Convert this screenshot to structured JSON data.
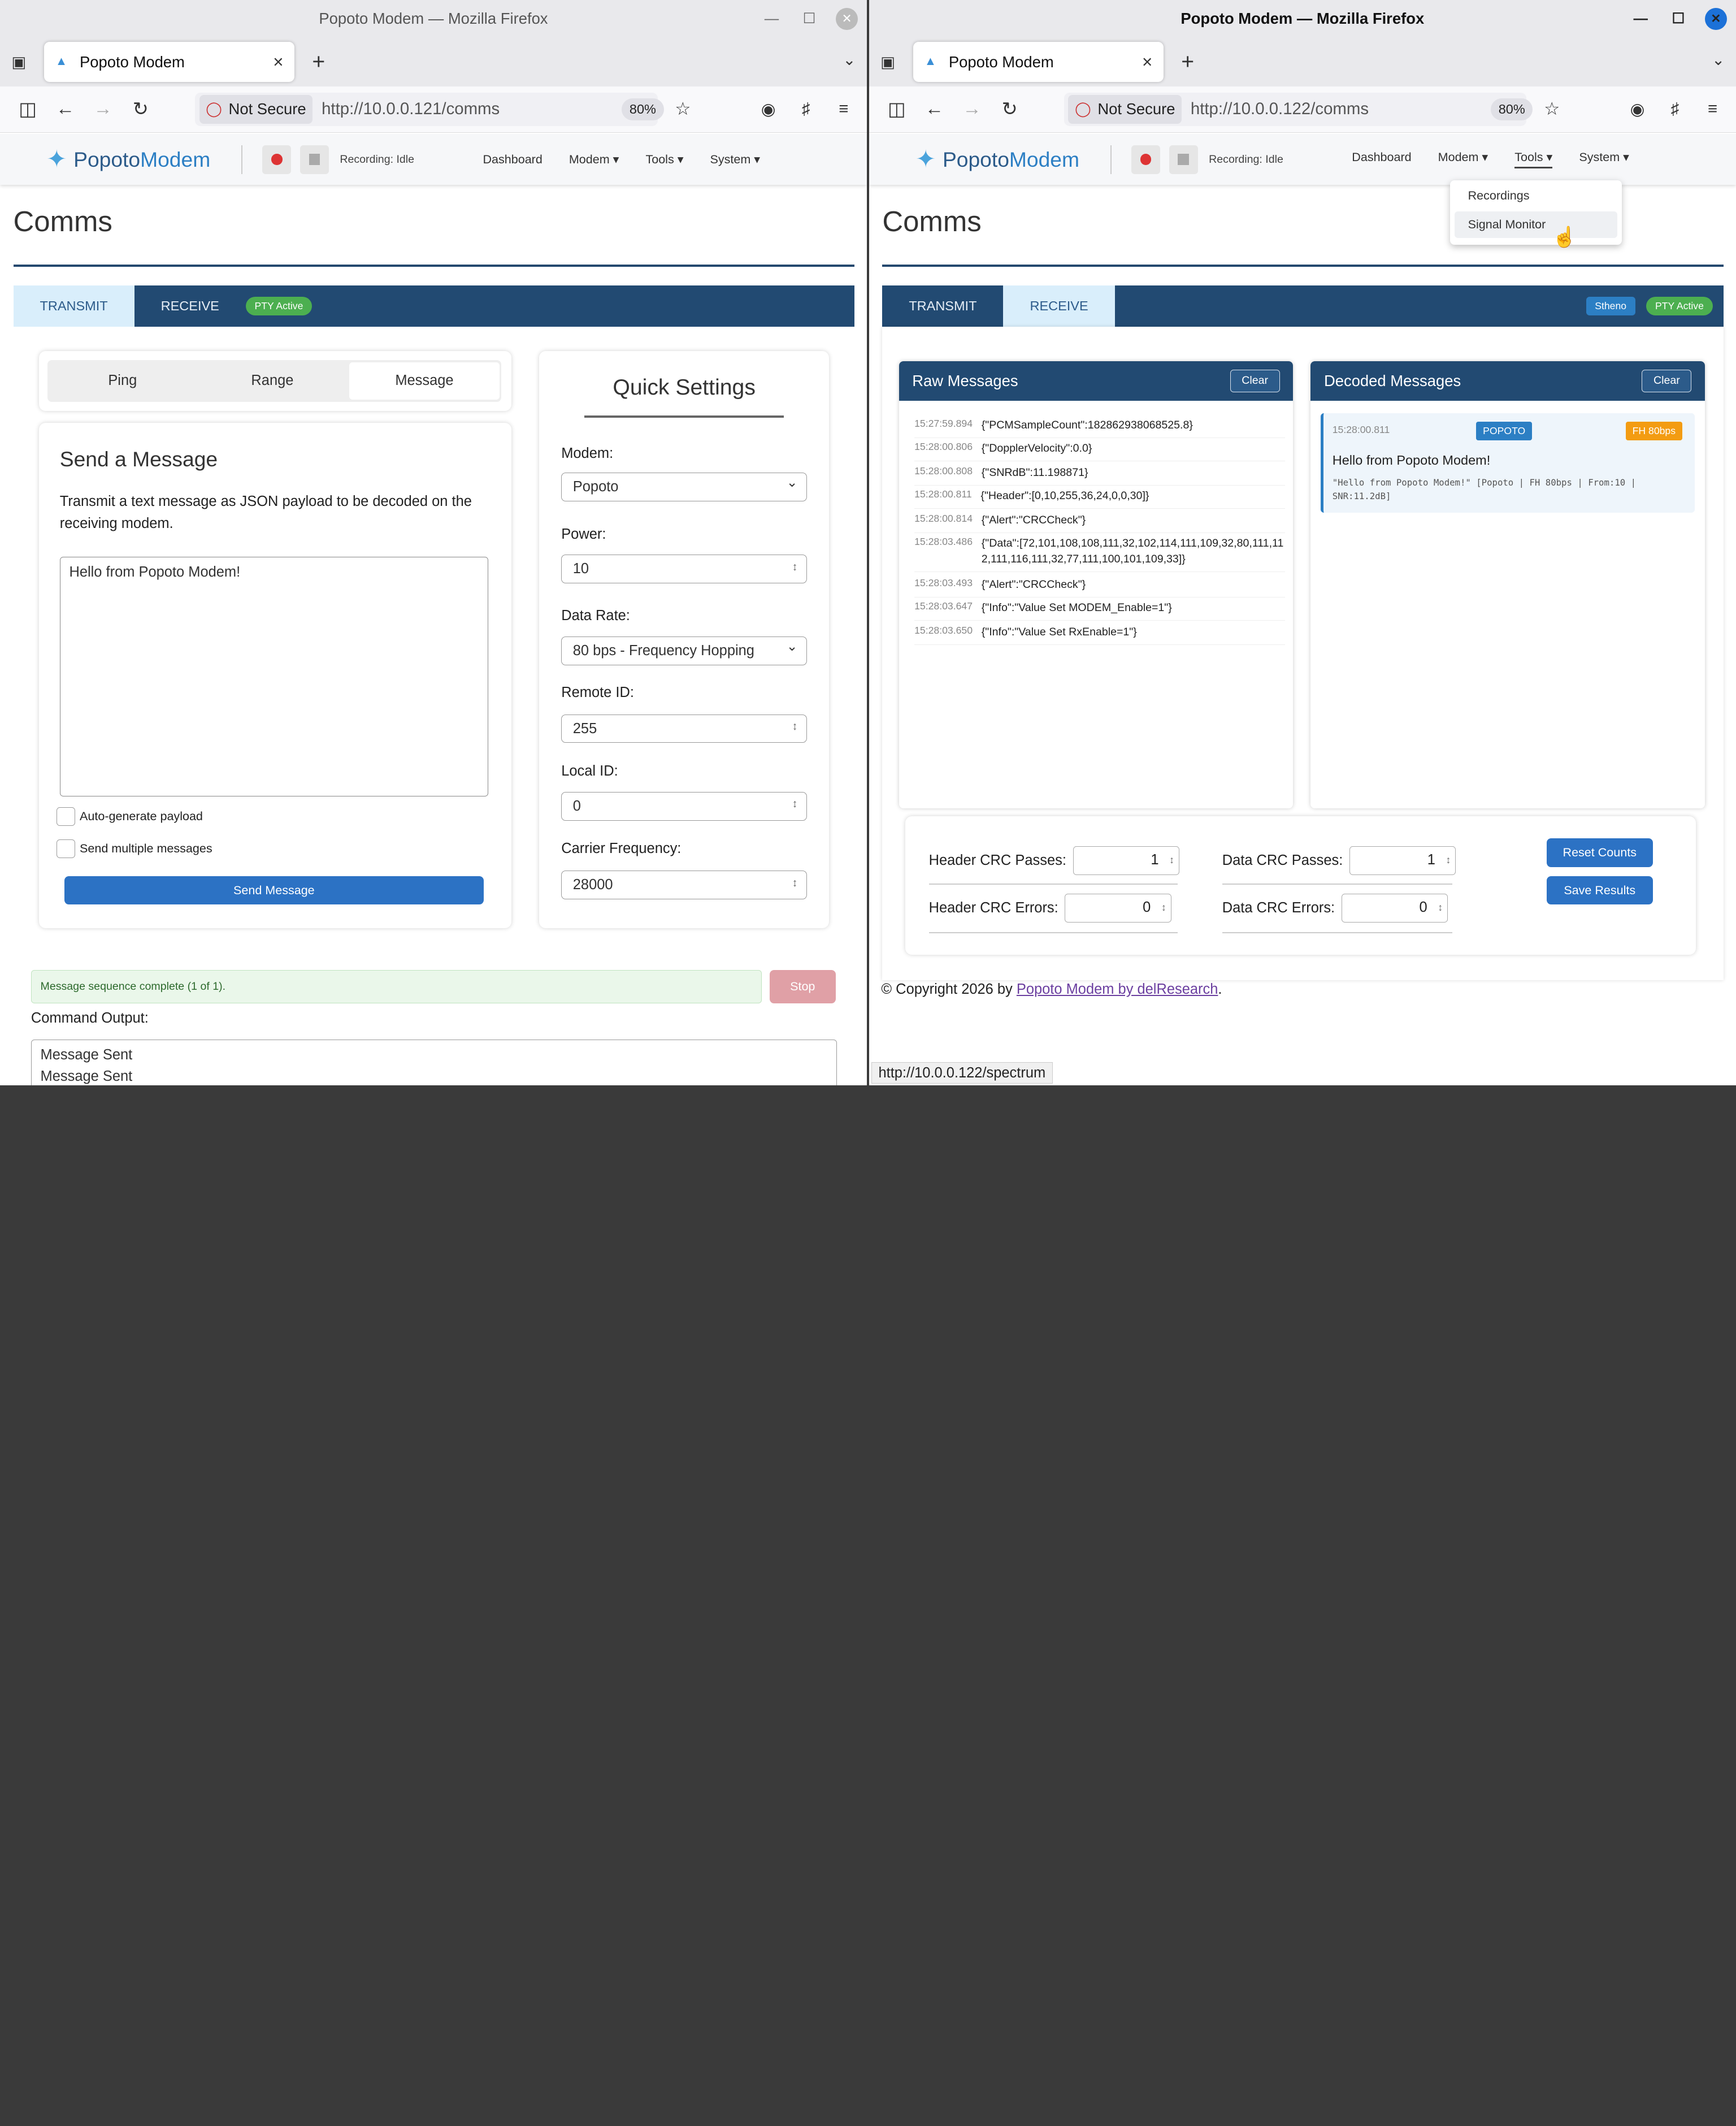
{
  "left": {
    "title": "Popoto Modem — Mozilla Firefox",
    "tab": "Popoto Modem",
    "not_secure": "Not Secure",
    "url": "http://10.0.0.121/comms",
    "zoom": "80%",
    "brand": {
      "a": "Popoto",
      "b": "Modem"
    },
    "rec": "Recording: Idle",
    "menu": [
      "Dashboard",
      "Modem",
      "Tools",
      "System"
    ],
    "heading": "Comms",
    "tabs": {
      "transmit": "TRANSMIT",
      "receive": "RECEIVE",
      "pty": "PTY Active"
    },
    "seg": [
      "Ping",
      "Range",
      "Message"
    ],
    "send_title": "Send a Message",
    "send_desc": "Transmit a text message as JSON payload to be decoded on the receiving modem.",
    "message": "Hello from Popoto Modem!",
    "cb1": "Auto-generate payload",
    "cb2": "Send multiple messages",
    "send_btn": "Send Message",
    "qs": {
      "title": "Quick Settings",
      "modem_l": "Modem:",
      "modem_v": "Popoto",
      "power_l": "Power:",
      "power_v": "10",
      "rate_l": "Data Rate:",
      "rate_v": "80 bps - Frequency Hopping",
      "rid_l": "Remote ID:",
      "rid_v": "255",
      "lid_l": "Local ID:",
      "lid_v": "0",
      "cf_l": "Carrier Frequency:",
      "cf_v": "28000"
    },
    "status": "Message sequence complete (1 of 1).",
    "stop": "Stop",
    "cmd_label": "Command Output:",
    "cmd_lines": [
      "Message Sent",
      "Message Sent"
    ]
  },
  "right": {
    "title": "Popoto Modem — Mozilla Firefox",
    "tab": "Popoto Modem",
    "not_secure": "Not Secure",
    "url": "http://10.0.0.122/comms",
    "zoom": "80%",
    "brand": {
      "a": "Popoto",
      "b": "Modem"
    },
    "rec": "Recording: Idle",
    "menu": [
      "Dashboard",
      "Modem",
      "Tools",
      "System"
    ],
    "dropdown": [
      "Recordings",
      "Signal Monitor"
    ],
    "heading": "Comms",
    "tabs": {
      "transmit": "TRANSMIT",
      "receive": "RECEIVE",
      "stheno": "Stheno",
      "pty": "PTY Active"
    },
    "raw_title": "Raw Messages",
    "dec_title": "Decoded Messages",
    "clear": "Clear",
    "raw": [
      {
        "ts": "15:27:59.894",
        "msg": "{\"PCMSampleCount\":182862938068525.8}"
      },
      {
        "ts": "15:28:00.806",
        "msg": "{\"DopplerVelocity\":0.0}"
      },
      {
        "ts": "15:28:00.808",
        "msg": "{\"SNRdB\":11.198871}"
      },
      {
        "ts": "15:28:00.811",
        "msg": "{\"Header\":[0,10,255,36,24,0,0,30]}"
      },
      {
        "ts": "15:28:00.814",
        "msg": "{\"Alert\":\"CRCCheck\"}"
      },
      {
        "ts": "15:28:03.486",
        "msg": "{\"Data\":[72,101,108,108,111,32,102,114,111,109,32,80,111,112,111,116,111,32,77,111,100,101,109,33]}"
      },
      {
        "ts": "15:28:03.493",
        "msg": "{\"Alert\":\"CRCCheck\"}"
      },
      {
        "ts": "15:28:03.647",
        "msg": "{\"Info\":\"Value Set MODEM_Enable=1\"}"
      },
      {
        "ts": "15:28:03.650",
        "msg": "{\"Info\":\"Value Set RxEnable=1\"}"
      }
    ],
    "decoded": {
      "ts": "15:28:00.811",
      "tag1": "POPOTO",
      "tag2": "FH 80bps",
      "text": "Hello from Popoto Modem!",
      "detail": "\"Hello from Popoto Modem!\" [Popoto | FH 80bps | From:10 | SNR:11.2dB]"
    },
    "crc": {
      "hp_l": "Header CRC Passes:",
      "hp_v": "1",
      "dp_l": "Data CRC Passes:",
      "dp_v": "1",
      "he_l": "Header CRC Errors:",
      "he_v": "0",
      "de_l": "Data CRC Errors:",
      "de_v": "0",
      "reset": "Reset Counts",
      "save": "Save Results"
    },
    "footer_pre": "© Copyright 2026 by ",
    "footer_link": "Popoto Modem by delResearch",
    "footer_post": ".",
    "statusbar": "http://10.0.0.122/spectrum"
  }
}
